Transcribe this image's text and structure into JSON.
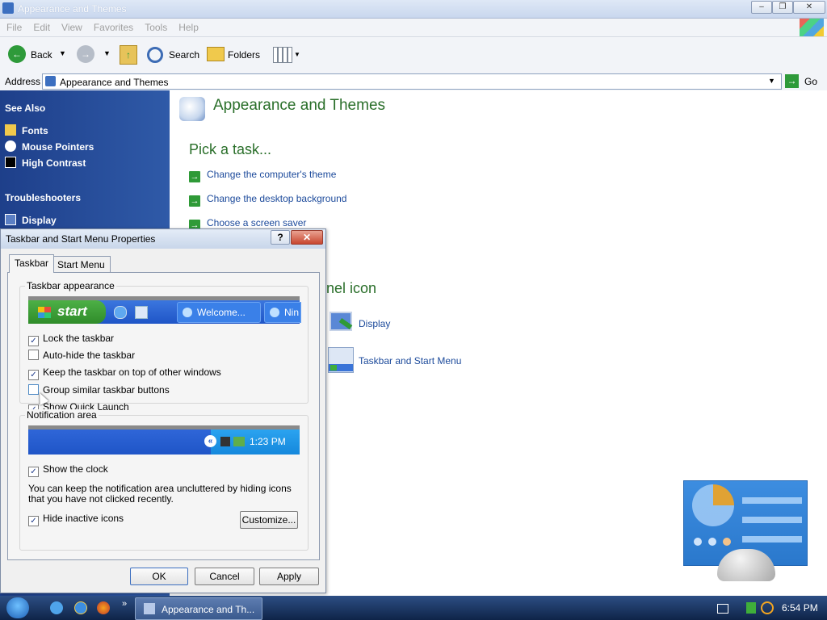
{
  "window": {
    "title": "Appearance and Themes"
  },
  "menubar": [
    "File",
    "Edit",
    "View",
    "Favorites",
    "Tools",
    "Help"
  ],
  "toolbar": {
    "back": "Back",
    "search": "Search",
    "folders": "Folders"
  },
  "address": {
    "label": "Address",
    "value": "Appearance and Themes",
    "go": "Go"
  },
  "sidebar": {
    "see_also": "See Also",
    "see_also_items": [
      "Fonts",
      "Mouse Pointers",
      "High Contrast"
    ],
    "troubleshooters": "Troubleshooters",
    "troubleshooter_items": [
      "Display"
    ]
  },
  "main": {
    "title": "Appearance and Themes",
    "pick_task": "Pick a task...",
    "tasks": [
      "Change the computer's theme",
      "Change the desktop background",
      "Choose a screen saver"
    ],
    "cp_heading": "nel icon",
    "cp_items": [
      "Display",
      "Taskbar and Start Menu"
    ]
  },
  "dialog": {
    "title": "Taskbar and Start Menu Properties",
    "tabs": [
      "Taskbar",
      "Start Menu"
    ],
    "taskbar_group": "Taskbar appearance",
    "preview": {
      "start": "start",
      "welcome": "Welcome...",
      "nin": "Nin"
    },
    "options": [
      {
        "label": "Lock the taskbar",
        "checked": true
      },
      {
        "label": "Auto-hide the taskbar",
        "checked": false
      },
      {
        "label": "Keep the taskbar on top of other windows",
        "checked": true
      },
      {
        "label": "Group similar taskbar buttons",
        "checked": false
      },
      {
        "label": "Show Quick Launch",
        "checked": true
      }
    ],
    "notif_group": "Notification area",
    "notif_time": "1:23 PM",
    "show_clock": "Show the clock",
    "desc": "You can keep the notification area uncluttered by hiding icons that you have not clicked recently.",
    "hide_inactive": "Hide inactive icons",
    "customize": "Customize...",
    "ok": "OK",
    "cancel": "Cancel",
    "apply": "Apply"
  },
  "taskbar": {
    "task_label": "Appearance and Th...",
    "clock": "6:54 PM"
  }
}
